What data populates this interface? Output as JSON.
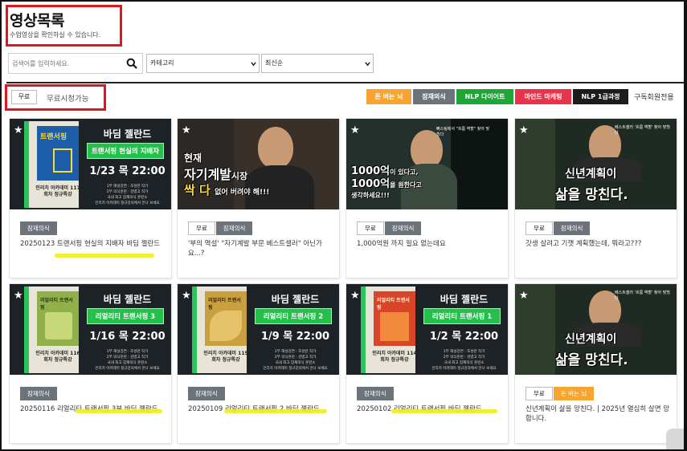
{
  "page": {
    "title": "영상목록",
    "subtitle": "수업영상을 확인하실 수 있습니다."
  },
  "filters": {
    "search_placeholder": "검색어를 입력하세요.",
    "category": "카테고리",
    "sort": "최신순"
  },
  "free": {
    "button": "무료",
    "label": "무료시청가능"
  },
  "categories": [
    {
      "label": "돈 버는 뇌",
      "color": "#f7a530"
    },
    {
      "label": "잠재의식",
      "color": "#6d737a"
    },
    {
      "label": "NLP 다이어트",
      "color": "#1fa637"
    },
    {
      "label": "마인드 마케팅",
      "color": "#e8344a"
    },
    {
      "label": "NLP 1급과정",
      "color": "#1c1c1c"
    }
  ],
  "subscriber_only": "구독회원전용",
  "videos": [
    {
      "tags": [
        "잠재의식"
      ],
      "title": "20250123 트랜서핑 현실의 지배자 바딤 젤란드",
      "thumb": {
        "heading": "바딤 젤란드",
        "green": "트랜서핑 현실의 지배자",
        "date": "1/23 목 22:00",
        "book": "트랜서핑",
        "caption": "인리치 아카데미 117회차 정규특강",
        "line1": "1부 해설강연 : 조성란 작가",
        "line2": "2부 의식훈련 : 김병고 작가",
        "line3": "국내 최고 잠재의식 훈련소",
        "line4": "인리치 아카데미 정규강의에서 만나 보세요"
      }
    },
    {
      "tags": [
        "무료",
        "잠재의식"
      ],
      "title": "'부의 역설' \"자기계발 부문 베스트셀러\" 아닌가요...?",
      "thumb": {
        "line1": "현재",
        "line2": "자기계발",
        "line3": "시장",
        "line4": "싹 다",
        "line5": "없어 버려야 해!!!"
      }
    },
    {
      "tags": [
        "무료",
        "잠재의식"
      ],
      "title": "1,000억원 까지 필요 없는데요",
      "thumb": {
        "line1": "1000억",
        "line2": "이 있다고,",
        "line3": "1000억",
        "line4": "을 원한다고",
        "line5": "생각하세요!!!",
        "bubble": "뻐스팅에서 \"흐름 역할\" 찾아 맞췄다"
      }
    },
    {
      "tags": [
        "무료",
        "잠재의식"
      ],
      "title": "갓생 살려고 기깻 계획했는데, 뭐라고???",
      "thumb": {
        "line1": "신년계획이",
        "line2": "삶을 망친다.",
        "bubble": "베스트셀러 '흐름 역할' 찾아 맞췄다"
      }
    },
    {
      "tags": [
        "잠재의식"
      ],
      "title": "20250116 리얼리티 트랜서핑 3부 바딤 젤란드",
      "thumb": {
        "heading": "바딤 젤란드",
        "green": "리얼리티 트랜서핑 3",
        "date": "1/16 목 22:00",
        "book": "리얼리티 트랜서핑",
        "caption": "인리치 아카데미 116회차 정규특강",
        "line1": "1부 해설강연 : 조성란 작가",
        "line2": "2부 의식훈련 : 김병고 작가",
        "line3": "국내 최고 잠재의식 훈련소",
        "line4": "인리치 아카데미 정규강의에서 만나 보세요"
      }
    },
    {
      "tags": [
        "잠재의식"
      ],
      "title": "20250109 리얼리티 트랜서핑 2 바딤 젤란드",
      "thumb": {
        "heading": "바딤 젤란드",
        "green": "리얼리티 트랜서핑 2",
        "date": "1/9 목 22:00",
        "book": "리얼리티 트랜서핑",
        "caption": "인리치 아카데미 115회차 정규특강",
        "line1": "1부 해설강연 : 조성란 작가",
        "line2": "2부 의식훈련 : 김병고 작가",
        "line3": "국내 최고 잠재의식 훈련소",
        "line4": "인리치 아카데미 정규강의에서 만나 보세요"
      }
    },
    {
      "tags": [
        "잠재의식"
      ],
      "title": "20250102 리얼리티 트랜서핑 바딤 젤란드",
      "thumb": {
        "heading": "바딤 젤란드",
        "green": "리얼리티 트랜서핑 1",
        "date": "1/2 목 22:00",
        "book": "리얼리티 트랜서핑",
        "caption": "인리치 아카데미 114회차 정규특강",
        "line1": "1부 해설강연 : 조성란 작가",
        "line2": "2부 의식훈련 : 김병고 작가",
        "line3": "국내 최고 잠재의식 훈련소",
        "line4": "인리치 아카데미 정규강의에서 만나 보세요"
      }
    },
    {
      "tags": [
        "무료",
        "돈 버는 뇌"
      ],
      "title": "신년계획이 삶을 망친다. | 2025년 열심히 살면 망합니다.",
      "thumb": {
        "line1": "신년계획이",
        "line2": "삶을 망친다.",
        "bubble": "베스트셀러 '흐름 역할' 찾아 맞췄다"
      }
    }
  ]
}
